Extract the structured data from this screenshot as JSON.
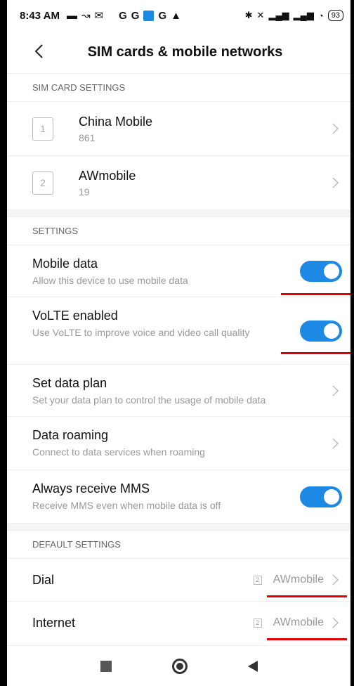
{
  "status_bar": {
    "time": "8:43 AM",
    "left_icons": [
      "message-icon",
      "missed-call-icon",
      "gmail-icon",
      "google-icon",
      "google-icon",
      "app-icon",
      "google-icon",
      "warning-icon"
    ],
    "g_letter": "G",
    "right_icons": [
      "bluetooth-icon",
      "mute-icon",
      "signal-icon",
      "lte-signal-icon",
      "wifi-icon"
    ],
    "battery": "93"
  },
  "header": {
    "title": "SIM cards & mobile networks"
  },
  "sim_section": {
    "label": "SIM CARD SETTINGS",
    "cards": [
      {
        "slot": "1",
        "name": "China Mobile",
        "number": "861"
      },
      {
        "slot": "2",
        "name": "AWmobile",
        "number": "19"
      }
    ]
  },
  "settings_section": {
    "label": "SETTINGS",
    "items": [
      {
        "title": "Mobile data",
        "subtitle": "Allow this device to use mobile data",
        "toggle": true
      },
      {
        "title": "VoLTE enabled",
        "subtitle": "Use VoLTE to improve voice and video call quality",
        "toggle": true
      },
      {
        "title": "Set data plan",
        "subtitle": "Set your data plan to control the usage of mobile data",
        "toggle": null
      },
      {
        "title": "Data roaming",
        "subtitle": "Connect to data services when roaming",
        "toggle": null
      },
      {
        "title": "Always receive MMS",
        "subtitle": "Receive MMS even when mobile data is off",
        "toggle": true
      }
    ]
  },
  "default_section": {
    "label": "DEFAULT SETTINGS",
    "items": [
      {
        "title": "Dial",
        "slot": "2",
        "value": "AWmobile"
      },
      {
        "title": "Internet",
        "slot": "2",
        "value": "AWmobile"
      }
    ]
  },
  "colors": {
    "accent": "#1e88e5",
    "annotation": "#e00000"
  }
}
